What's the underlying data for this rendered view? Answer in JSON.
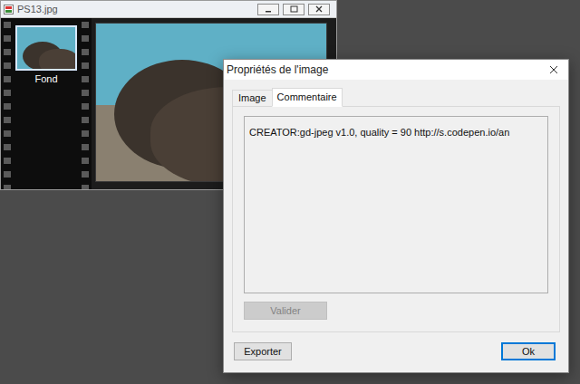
{
  "editor_window": {
    "title": "PS13.jpg"
  },
  "layers": [
    {
      "label": "Fond",
      "selected": true
    }
  ],
  "dialog": {
    "title": "Propriétés de l'image",
    "tabs": [
      {
        "label": "Image",
        "selected": false
      },
      {
        "label": "Commentaire",
        "selected": true
      }
    ],
    "comment": "CREATOR:gd-jpeg v1.0, quality = 90 http://s.codepen.io/an",
    "validate_button": {
      "label": "Valider",
      "disabled": true
    },
    "buttons": [
      {
        "label": "Exporter",
        "default": false
      },
      {
        "label": "Ok",
        "default": true
      }
    ]
  }
}
